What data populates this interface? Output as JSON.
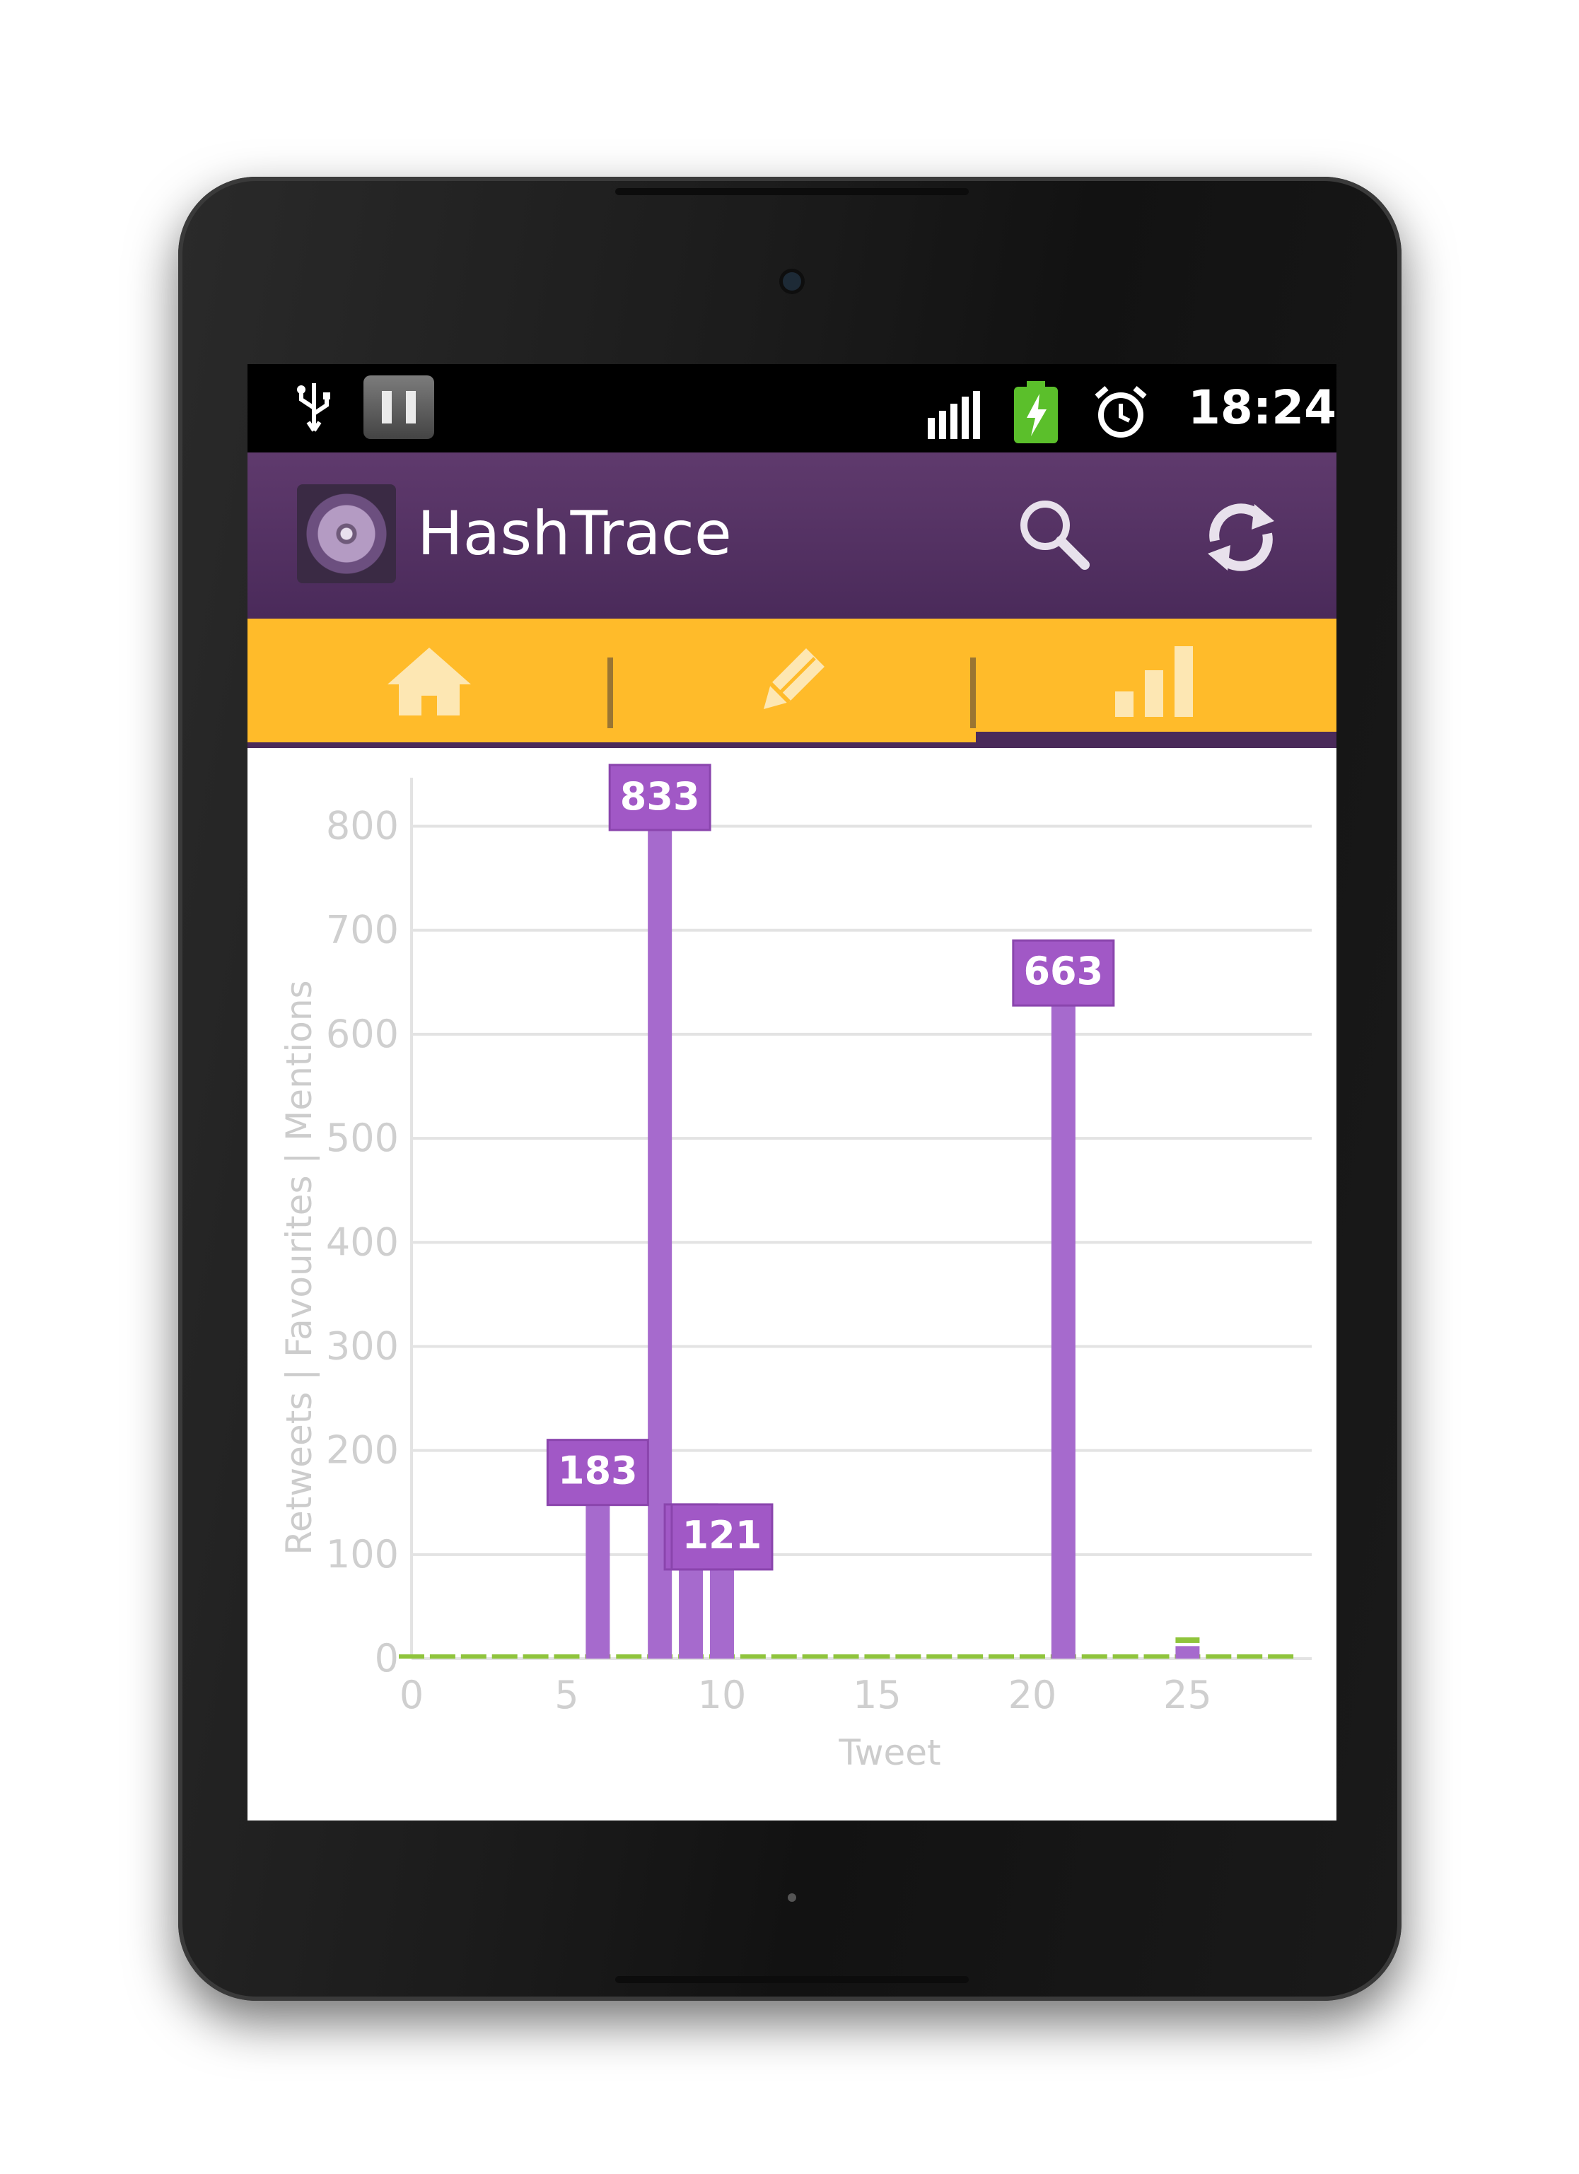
{
  "status_bar": {
    "time": "18:24",
    "icons": [
      "usb-icon",
      "notification-icon",
      "signal-icon",
      "battery-charging-icon",
      "alarm-icon"
    ]
  },
  "action_bar": {
    "title": "HashTrace",
    "logo_icon": "hashtrace-logo",
    "actions": [
      "search-icon",
      "refresh-icon"
    ],
    "background": "#4f2d5f"
  },
  "tabs": {
    "items": [
      "home-icon",
      "compose-icon",
      "stats-icon"
    ],
    "selected": "stats-icon",
    "background": "#ffbb2a"
  },
  "chart_data": {
    "type": "bar",
    "xlabel": "Tweet",
    "ylabel": "Retweets | Favourites | Mentions",
    "xlim": [
      0,
      29
    ],
    "ylim": [
      0,
      833
    ],
    "x_ticks": [
      "0",
      "5",
      "10",
      "15",
      "20",
      "25"
    ],
    "y_ticks": [
      "0",
      "100",
      "200",
      "300",
      "400",
      "500",
      "600",
      "700",
      "800"
    ],
    "grid": true,
    "series_colors": {
      "retweets": "#a66acd",
      "favourites": "#8fc43c",
      "mentions": "#f5a623"
    },
    "bars": [
      {
        "x": 6,
        "retweets": 183,
        "favourites": 1
      },
      {
        "x": 8,
        "retweets": 833
      },
      {
        "x": 9,
        "retweets": 121,
        "favourites": 1
      },
      {
        "x": 10,
        "retweets": 121,
        "favourites": 1
      },
      {
        "x": 21,
        "retweets": 663,
        "favourites": 1
      },
      {
        "x": 25,
        "retweets": 12,
        "favourites": 3
      }
    ],
    "data_labels": [
      {
        "x": 6,
        "value": 183,
        "text": "183"
      },
      {
        "x": 8,
        "value": 833,
        "text": "833"
      },
      {
        "x": 9,
        "value": 121,
        "text": "1"
      },
      {
        "x": 10,
        "value": 121,
        "text": "121"
      },
      {
        "x": 21,
        "value": 663,
        "text": "663"
      }
    ]
  }
}
